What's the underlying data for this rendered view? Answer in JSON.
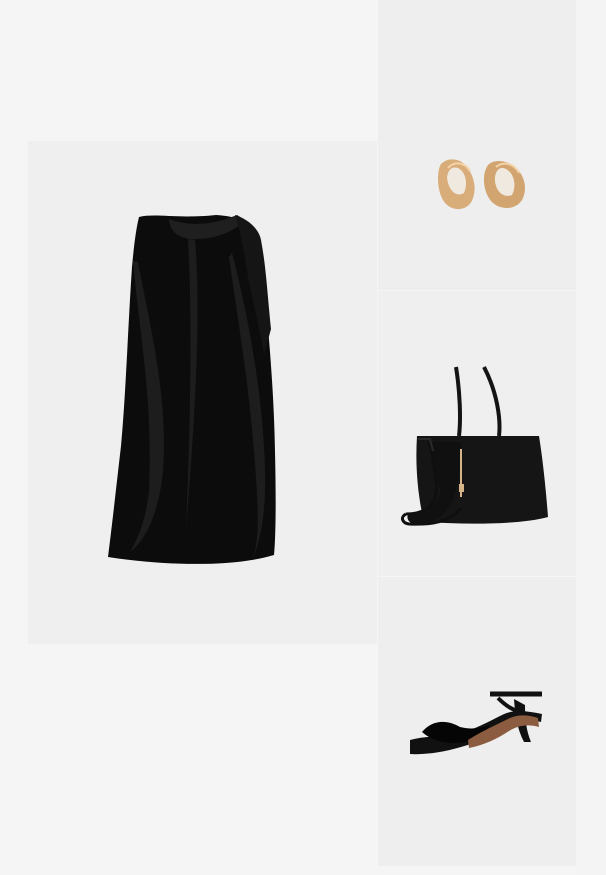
{
  "products": {
    "dress": {
      "icon": "black-satin-sleeveless-dress-icon",
      "color": "#0d0d0d"
    },
    "earrings": {
      "icon": "gold-hoop-earrings-icon",
      "color": "#d8ad7a"
    },
    "bag": {
      "icon": "black-tote-bag-icon",
      "color": "#141414"
    },
    "sandals": {
      "icon": "black-kitten-heel-sandal-icon",
      "color": "#111111"
    }
  },
  "colors": {
    "page_bg": "#f5f5f5",
    "tile_bg": "#eeeeee"
  }
}
